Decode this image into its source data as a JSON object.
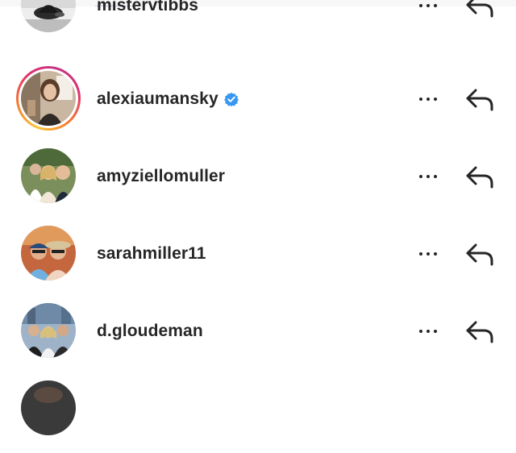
{
  "comments_likers": {
    "rows": [
      {
        "username": "mistervtibbs",
        "verified": false,
        "story_ring": false,
        "avatar_icon": "profile-photo"
      },
      {
        "username": "alexiaumansky",
        "verified": true,
        "story_ring": true,
        "avatar_icon": "profile-photo"
      },
      {
        "username": "amyziellomuller",
        "verified": false,
        "story_ring": false,
        "avatar_icon": "profile-photo"
      },
      {
        "username": "sarahmiller11",
        "verified": false,
        "story_ring": false,
        "avatar_icon": "profile-photo"
      },
      {
        "username": "d.gloudeman",
        "verified": false,
        "story_ring": false,
        "avatar_icon": "profile-photo"
      }
    ],
    "actions": {
      "more_icon": "more-dots-icon",
      "reply_icon": "reply-arrow-icon"
    },
    "colors": {
      "verified_badge": "#3897f0",
      "text": "#262626",
      "story_ring_start": "#f9c43b",
      "story_ring_end": "#c13584"
    }
  }
}
